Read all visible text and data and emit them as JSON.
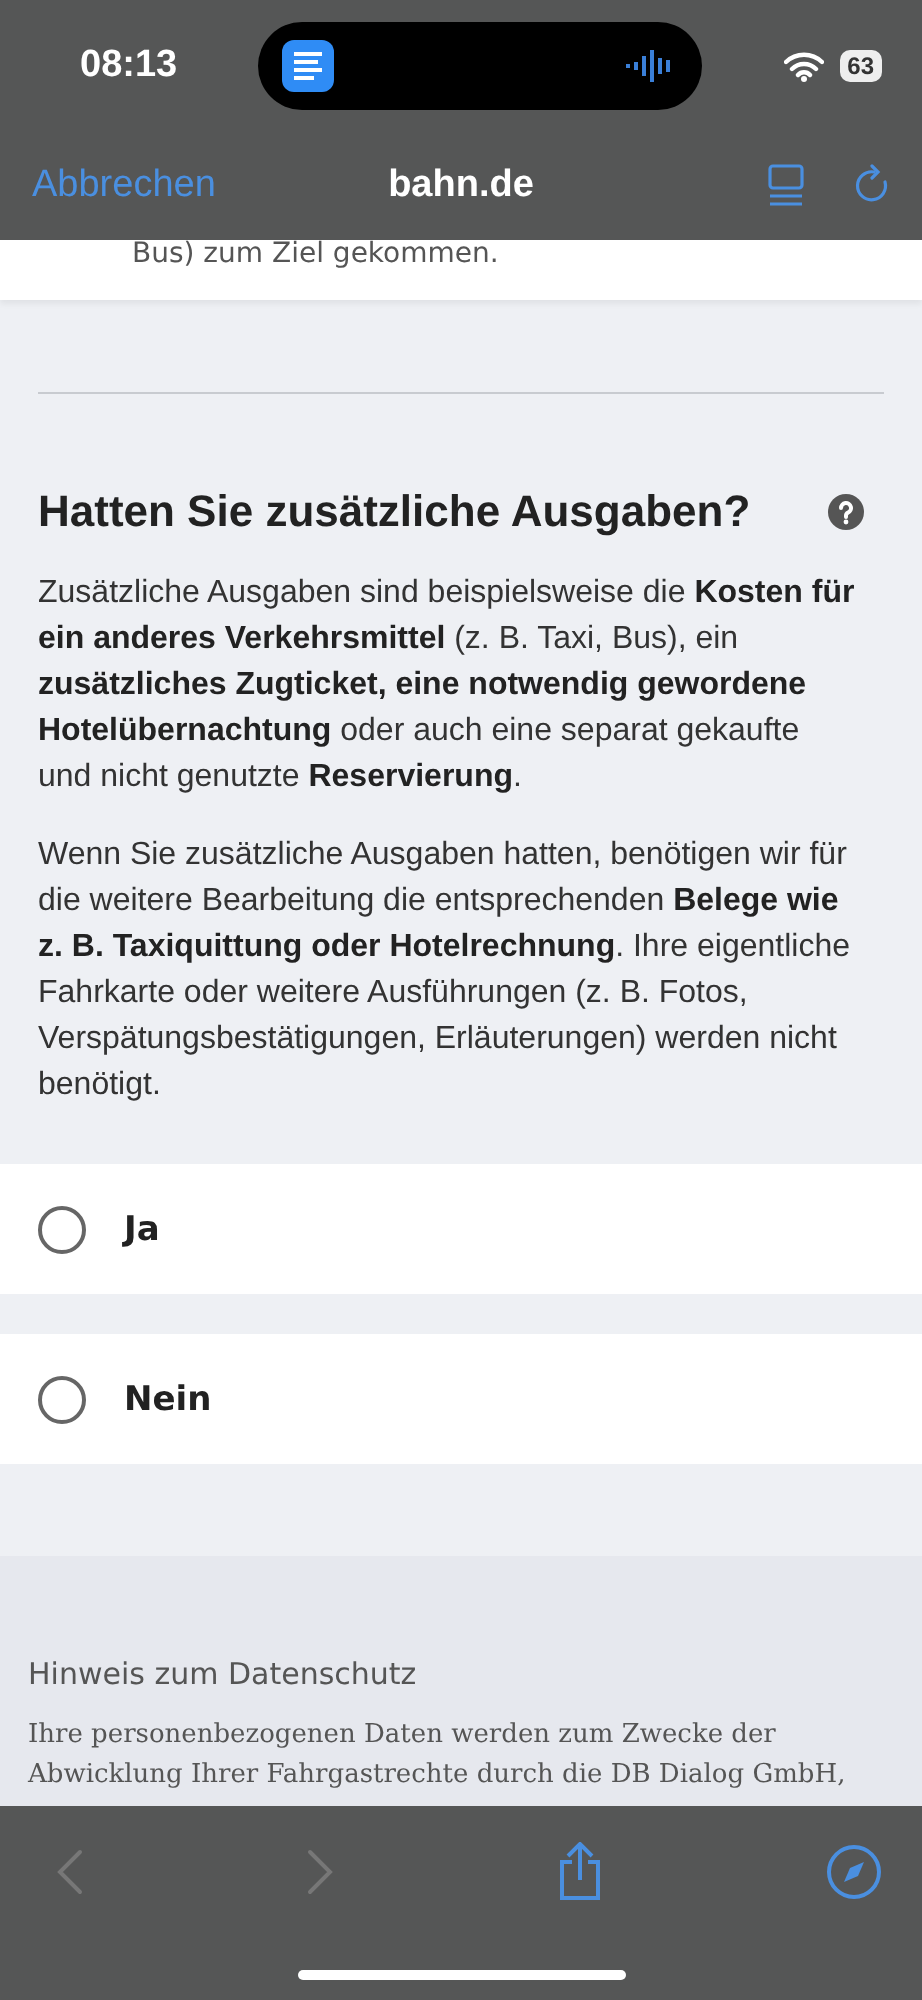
{
  "status_bar": {
    "time": "08:13",
    "battery": "63"
  },
  "nav_bar": {
    "cancel": "Abbrechen",
    "title": "bahn.de"
  },
  "previous_card": {
    "text": "Bus) zum Ziel gekommen."
  },
  "section": {
    "heading": "Hatten Sie zusätzliche Ausgaben?",
    "paragraphs": [
      "Zusätzliche Ausgaben sind beispielsweise die **Kosten für ein anderes Verkehrsmittel** (z. B. Taxi, Bus), ein **zusätzliches Zugticket, eine notwendig gewordene Hotelübernachtung** oder auch eine separat gekaufte und nicht genutzte **Reservierung**.",
      "Wenn Sie zusätzliche Ausgaben hatten, benötigen wir für die weitere Bearbeitung die entsprechenden **Belege wie z. B. Taxiquittung oder Hotelrechnung**. Ihre eigentliche Fahrkarte oder weitere Ausführungen (z. B. Fotos, Verspätungsbestätigungen, Erläuterungen) werden nicht benötigt."
    ]
  },
  "options": [
    {
      "label": "Ja",
      "selected": false
    },
    {
      "label": "Nein",
      "selected": false
    }
  ],
  "privacy": {
    "heading": "Hinweis zum Datenschutz",
    "text": "Ihre personenbezogenen Daten werden zum Zwecke der Abwicklung Ihrer Fahrgastrechte durch die DB Dialog GmbH,"
  },
  "toolbar": {
    "back_disabled": true,
    "forward_disabled": true
  }
}
